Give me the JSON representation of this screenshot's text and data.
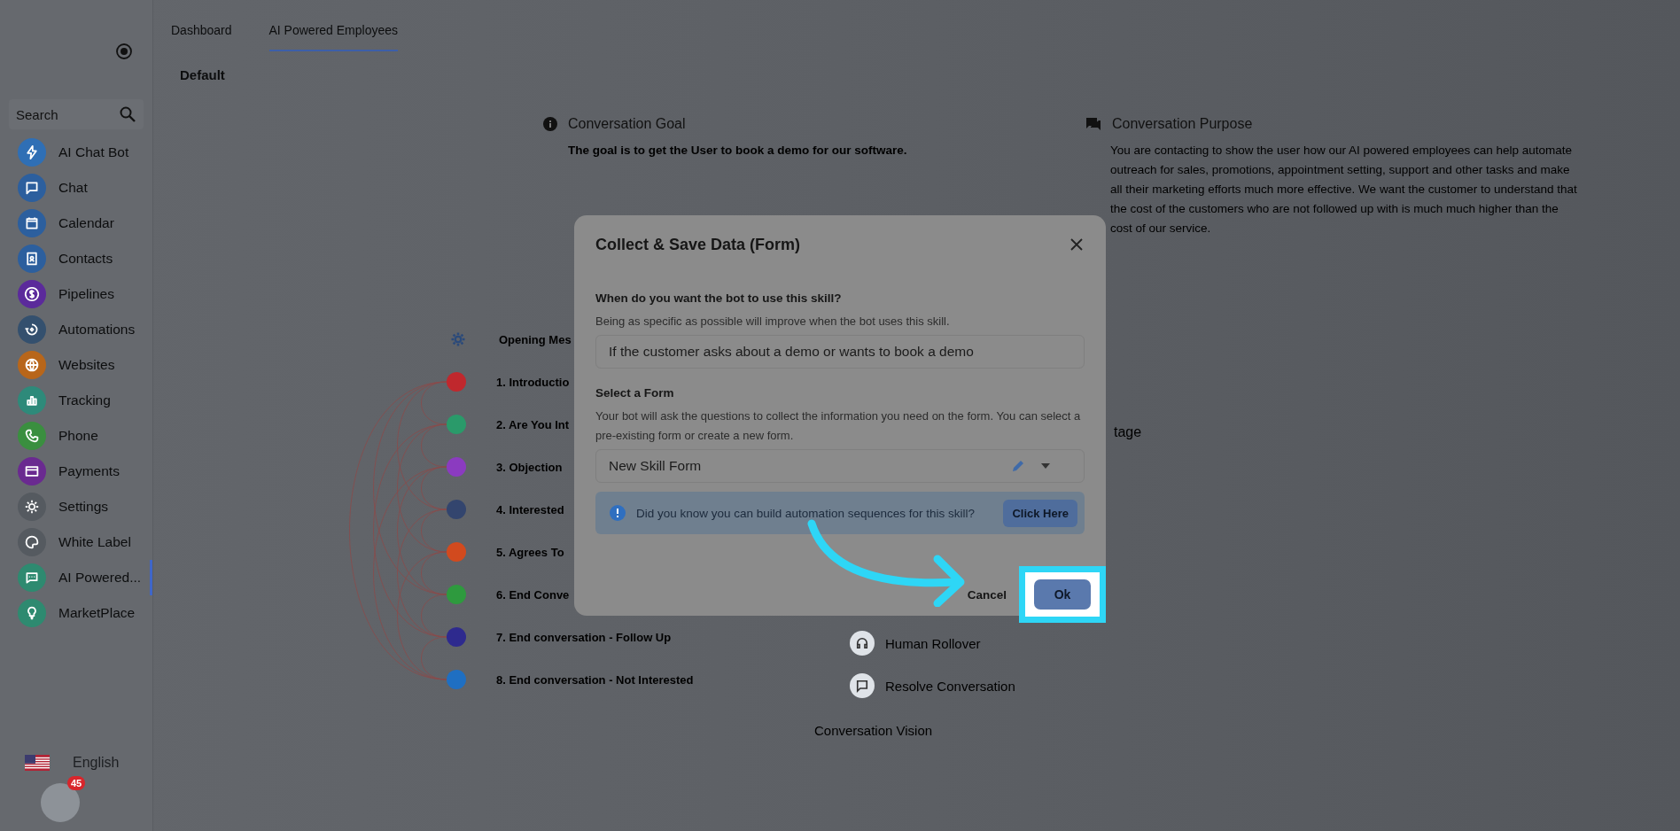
{
  "sidebar": {
    "search": {
      "placeholder": "Search"
    },
    "items": [
      {
        "label": "AI Chat Bot",
        "kind": "bolt",
        "color": "#2f6fb5",
        "selected": false
      },
      {
        "label": "Chat",
        "kind": "chat",
        "color": "#2c5f9e",
        "selected": false
      },
      {
        "label": "Calendar",
        "kind": "calendar",
        "color": "#2c5f9e",
        "selected": false
      },
      {
        "label": "Contacts",
        "kind": "contact",
        "color": "#2c5f9e",
        "selected": false
      },
      {
        "label": "Pipelines",
        "kind": "dollar",
        "color": "#5b2a9b",
        "selected": false
      },
      {
        "label": "Automations",
        "kind": "automation",
        "color": "#34506e",
        "selected": false
      },
      {
        "label": "Websites",
        "kind": "globe",
        "color": "#b8661a",
        "selected": false
      },
      {
        "label": "Tracking",
        "kind": "chart",
        "color": "#2e8a7a",
        "selected": false
      },
      {
        "label": "Phone",
        "kind": "phone",
        "color": "#3a8f3f",
        "selected": false
      },
      {
        "label": "Payments",
        "kind": "card",
        "color": "#6a2a90",
        "selected": false
      },
      {
        "label": "Settings",
        "kind": "gear",
        "color": "#555a60",
        "selected": false
      },
      {
        "label": "White Label",
        "kind": "palette",
        "color": "#555a60",
        "selected": false
      },
      {
        "label": "AI Powered...",
        "kind": "message",
        "color": "#2e8a70",
        "selected": true
      },
      {
        "label": "MarketPlace",
        "kind": "bulb",
        "color": "#2e8a70",
        "selected": false
      }
    ],
    "language": "English",
    "badge": "45"
  },
  "tabs": [
    {
      "label": "Dashboard",
      "selected": false
    },
    {
      "label": "AI Powered Employees",
      "selected": true
    }
  ],
  "sub_tab": "Default",
  "goal": {
    "title": "Conversation Goal",
    "text": "The goal is to get the User to book a demo for our software."
  },
  "purpose": {
    "title": "Conversation Purpose",
    "text": "You are contacting to show the user how our AI powered employees can help automate outreach for sales, promotions, appointment setting, support and other tasks and make all their marketing efforts much more effective. We want the customer to understand that the cost of the customers who are not followed up with is much much higher than the cost of our service."
  },
  "stages": {
    "header": "Opening Mes",
    "items": [
      {
        "label": "1. Introductio",
        "color": "#c0282d"
      },
      {
        "label": "2. Are You Int",
        "color": "#2a9a6a"
      },
      {
        "label": "3. Objection",
        "color": "#8b3bc0"
      },
      {
        "label": "4. Interested",
        "color": "#33456e"
      },
      {
        "label": "5. Agrees To",
        "color": "#d24a1e"
      },
      {
        "label": "6. End Conve",
        "color": "#2e9a3e"
      },
      {
        "label": "7. End conversation - Follow Up",
        "color": "#2e2a8e"
      },
      {
        "label": "8. End conversation - Not Interested",
        "color": "#1f6fc2"
      }
    ]
  },
  "stage_label": "tage",
  "actions": [
    {
      "label": "Human Rollover",
      "kind": "headset"
    },
    {
      "label": "Resolve Conversation",
      "kind": "chat"
    }
  ],
  "vision_title": "Conversation Vision",
  "dialog": {
    "title": "Collect & Save Data (Form)",
    "question": "When do you want the bot to use this skill?",
    "question_hint": "Being as specific as possible will improve when the bot uses this skill.",
    "answer": "If the customer asks about a demo or wants to book a demo",
    "form_label": "Select a Form",
    "form_hint": "Your bot will ask the questions to collect the information you need on the form. You can select a pre-existing form or create a new form.",
    "form_value": "New Skill Form",
    "info": "Did you know you can build automation sequences for this skill?",
    "info_button": "Click Here",
    "cancel": "Cancel",
    "ok": "Ok"
  }
}
